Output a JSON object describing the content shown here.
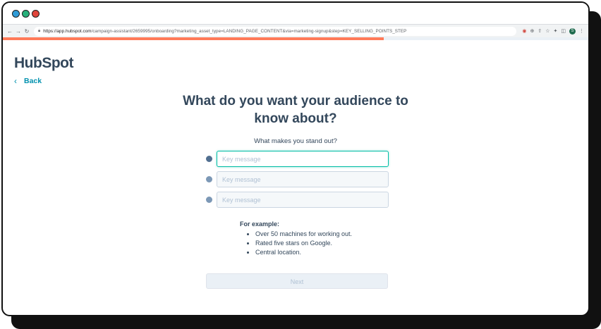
{
  "browser": {
    "url_host": "https://app.hubspot.com",
    "url_path": "/campaign-assistant/2659995/onboarding?marketing_asset_type=LANDING_PAGE_CONTENT&via=marketing-signup&step=KEY_SELLING_POINTS_STEP",
    "profile_initial": "S",
    "progress_percent": 65
  },
  "app": {
    "logo": "HubSpot",
    "back_label": "Back",
    "title_line1": "What do you want your audience to",
    "title_line2": "know about?",
    "subtitle": "What makes you stand out?",
    "inputs": [
      {
        "placeholder": "Key message",
        "value": ""
      },
      {
        "placeholder": "Key message",
        "value": ""
      },
      {
        "placeholder": "Key message",
        "value": ""
      }
    ],
    "example_heading": "For example:",
    "examples": [
      "Over 50 machines for working out.",
      "Rated five stars on Google.",
      "Central location."
    ],
    "next_label": "Next"
  },
  "colors": {
    "accent": "#ff7a59",
    "link": "#0091ae",
    "text": "#33475b",
    "focus": "#00bda5"
  }
}
